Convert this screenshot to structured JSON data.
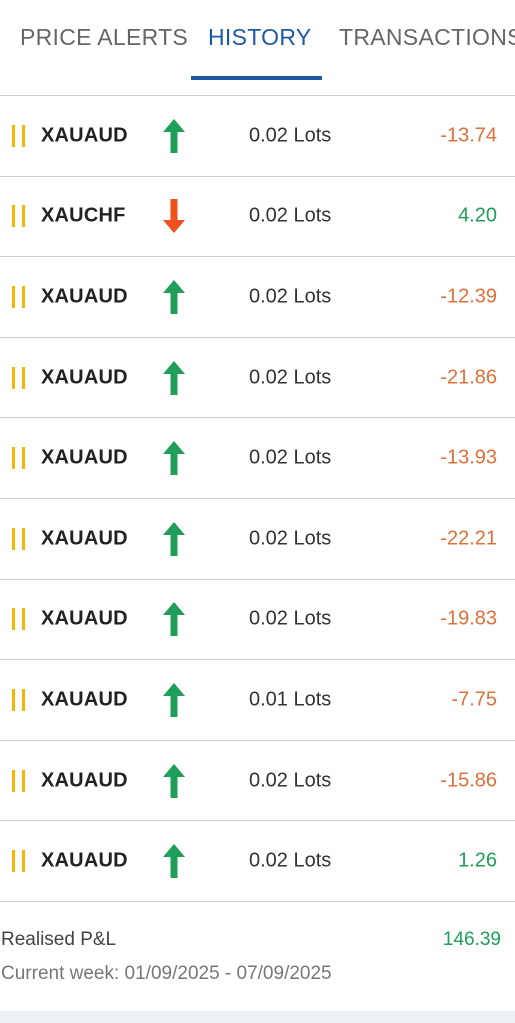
{
  "tabs": [
    {
      "label": "PRICE ALERTS",
      "active": false
    },
    {
      "label": "HISTORY",
      "active": true
    },
    {
      "label": "TRANSACTIONS",
      "active": false
    }
  ],
  "colors": {
    "accent": "#1e5aa3",
    "buy_arrow": "#1f9e5a",
    "sell_arrow": "#f0501e",
    "loss": "#e0703a",
    "profit": "#1f9e5a",
    "pause_icon": "#f2b705"
  },
  "history": [
    {
      "symbol": "XAUAUD",
      "direction": "up-arrow-icon",
      "lots": "0.02 Lots",
      "pnl": "-13.74",
      "sign": "neg"
    },
    {
      "symbol": "XAUCHF",
      "direction": "down-arrow-icon",
      "lots": "0.02 Lots",
      "pnl": "4.20",
      "sign": "pos"
    },
    {
      "symbol": "XAUAUD",
      "direction": "up-arrow-icon",
      "lots": "0.02 Lots",
      "pnl": "-12.39",
      "sign": "neg"
    },
    {
      "symbol": "XAUAUD",
      "direction": "up-arrow-icon",
      "lots": "0.02 Lots",
      "pnl": "-21.86",
      "sign": "neg"
    },
    {
      "symbol": "XAUAUD",
      "direction": "up-arrow-icon",
      "lots": "0.02 Lots",
      "pnl": "-13.93",
      "sign": "neg"
    },
    {
      "symbol": "XAUAUD",
      "direction": "up-arrow-icon",
      "lots": "0.02 Lots",
      "pnl": "-22.21",
      "sign": "neg"
    },
    {
      "symbol": "XAUAUD",
      "direction": "up-arrow-icon",
      "lots": "0.02 Lots",
      "pnl": "-19.83",
      "sign": "neg"
    },
    {
      "symbol": "XAUAUD",
      "direction": "up-arrow-icon",
      "lots": "0.01 Lots",
      "pnl": "-7.75",
      "sign": "neg"
    },
    {
      "symbol": "XAUAUD",
      "direction": "up-arrow-icon",
      "lots": "0.02 Lots",
      "pnl": "-15.86",
      "sign": "neg"
    },
    {
      "symbol": "XAUAUD",
      "direction": "up-arrow-icon",
      "lots": "0.02 Lots",
      "pnl": "1.26",
      "sign": "pos"
    }
  ],
  "summary": {
    "realised_label": "Realised P&L",
    "realised_value": "146.39",
    "week_text": "Current week: 01/09/2025 - 07/09/2025"
  }
}
